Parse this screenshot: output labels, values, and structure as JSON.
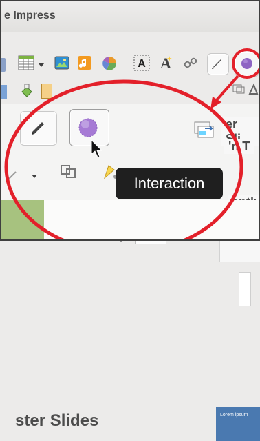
{
  "window": {
    "title": "e Impress"
  },
  "toolbar": {
    "icons": [
      "table-icon",
      "image-icon",
      "music-icon",
      "chart-icon",
      "textbox-icon",
      "fontwork-icon",
      "link-icon",
      "pencil-icon",
      "interaction-icon"
    ],
    "tooltip": "Interaction"
  },
  "panels": {
    "master_slides_title": "ster Slides",
    "right_labels": [
      "er Sli",
      "'n T",
      "ently"
    ],
    "thumbnail_caption": "Lorem ipsum"
  },
  "colors": {
    "annotation_red": "#e3202a",
    "interaction_purple": "#8d64c3",
    "accent_blue": "#4a79b0"
  }
}
